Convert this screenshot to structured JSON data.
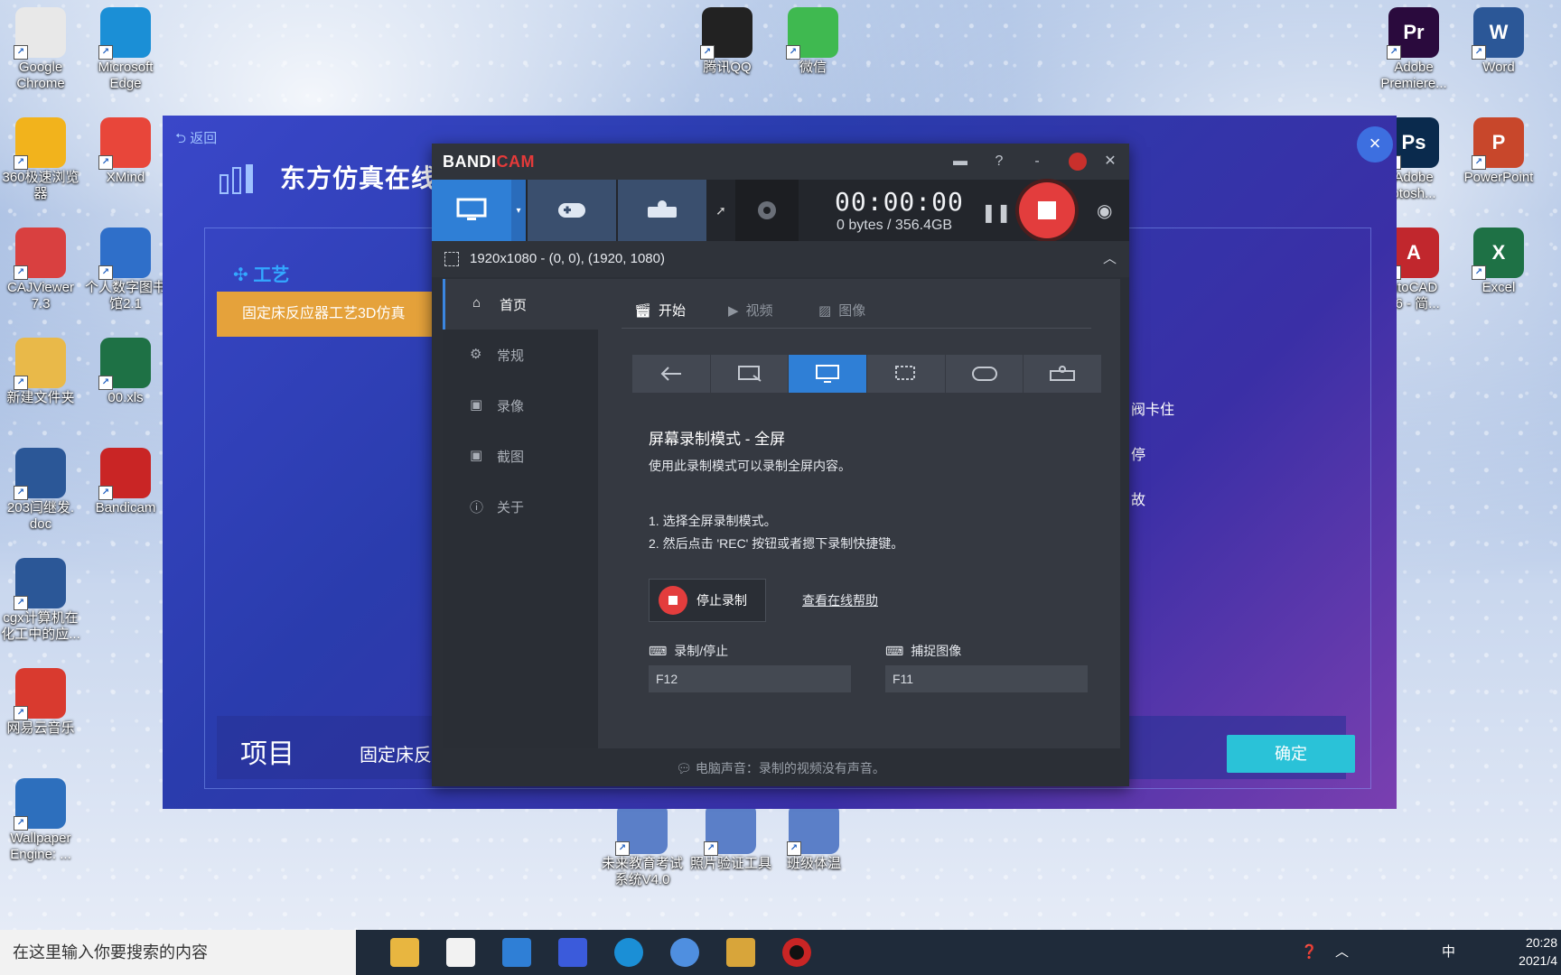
{
  "desktop": {
    "icons_left": [
      {
        "label": "Google\nChrome",
        "icon": "chrome-icon",
        "color": "#e8e8e8"
      },
      {
        "label": "Microsoft\nEdge",
        "icon": "edge-icon",
        "color": "#1b8fd6"
      },
      {
        "label": "360极速浏览\n器",
        "icon": "browser-360-icon",
        "color": "#f2b31c"
      },
      {
        "label": "XMind",
        "icon": "xmind-icon",
        "color": "#e8463a"
      },
      {
        "label": "CAJViewer\n7.3",
        "icon": "cajviewer-icon",
        "color": "#d94040"
      },
      {
        "label": "个人数字图书\n馆2.1",
        "icon": "library-icon",
        "color": "#2f6fc9"
      },
      {
        "label": "新建文件夹",
        "icon": "folder-icon",
        "color": "#e9b949"
      },
      {
        "label": "00.xls",
        "icon": "excel-file-icon",
        "color": "#1e7145"
      },
      {
        "label": "203闫继发.\ndoc",
        "icon": "word-file-icon",
        "color": "#2b5797"
      },
      {
        "label": "Bandicam",
        "icon": "bandicam-icon",
        "color": "#c92525"
      },
      {
        "label": "cgx计算机在\n化工中的应...",
        "icon": "word-file-icon",
        "color": "#2b5797"
      },
      {
        "label": "网易云音乐",
        "icon": "netease-music-icon",
        "color": "#d93a2f"
      },
      {
        "label": "Wallpaper\nEngine: ...",
        "icon": "wallpaper-engine-icon",
        "color": "#2d6fbd"
      }
    ],
    "icons_top": [
      {
        "label": "腾讯QQ",
        "icon": "qq-icon",
        "color": "#222222"
      },
      {
        "label": "微信",
        "icon": "wechat-icon",
        "color": "#3fb950"
      }
    ],
    "icons_right": [
      {
        "label": "Adobe\nPremiere...",
        "icon": "premiere-icon",
        "color": "#2a0a3d",
        "letters": "Pr"
      },
      {
        "label": "Word",
        "icon": "word-icon",
        "color": "#2b5797",
        "letters": "W"
      },
      {
        "label": "Adobe\notosh...",
        "icon": "photoshop-icon",
        "color": "#0a2a4d",
        "letters": "Ps"
      },
      {
        "label": "PowerPoint",
        "icon": "powerpoint-icon",
        "color": "#c8472b",
        "letters": "P"
      },
      {
        "label": "utoCAD\n16 - 简...",
        "icon": "autocad-icon",
        "color": "#c1272d",
        "letters": "A"
      },
      {
        "label": "Excel",
        "icon": "excel-icon",
        "color": "#1e7145",
        "letters": "X"
      }
    ],
    "icons_bottom": [
      {
        "label": "未来教育考试\n系统V4.0",
        "icon": "exam-system-icon"
      },
      {
        "label": "照片验证工具",
        "icon": "photo-tool-icon"
      },
      {
        "label": "班级体温",
        "icon": "document-icon"
      }
    ]
  },
  "app": {
    "back": "返回",
    "title": "东方仿真在线",
    "category": "工艺",
    "selected_item": "固定床反应器工艺3D仿真",
    "side_texts": [
      "阀卡住",
      "停",
      "故"
    ],
    "bottom_label": "项目",
    "bottom_value": "固定床反",
    "ok_button": "确定"
  },
  "bandicam": {
    "logo_main": "BANDI",
    "logo_accent": "CAM",
    "timer": "00:00:00",
    "size": "0 bytes / 356.4GB",
    "resolution": "1920x1080 - (0, 0), (1920, 1080)",
    "sidebar": [
      "首页",
      "常规",
      "录像",
      "截图",
      "关于"
    ],
    "tabs": [
      "开始",
      "视频",
      "图像"
    ],
    "mode_title": "屏幕录制模式 - 全屏",
    "mode_desc": "使用此录制模式可以录制全屏内容。",
    "step1": "1. 选择全屏录制模式。",
    "step2": "2. 然后点击 'REC' 按钮或者摁下录制快捷键。",
    "stop_button": "停止录制",
    "help_link": "查看在线帮助",
    "hotkey_record_label": "录制/停止",
    "hotkey_record_value": "F12",
    "hotkey_capture_label": "捕捉图像",
    "hotkey_capture_value": "F11",
    "footer": "电脑声音：录制的视频没有声音。",
    "accent_color": "#2f7fd6",
    "rec_color": "#e33d3d"
  },
  "taskbar": {
    "search_placeholder": "在这里输入你要搜索的内容",
    "tray_lang": "中",
    "time": "20:28",
    "date": "2021/4"
  }
}
